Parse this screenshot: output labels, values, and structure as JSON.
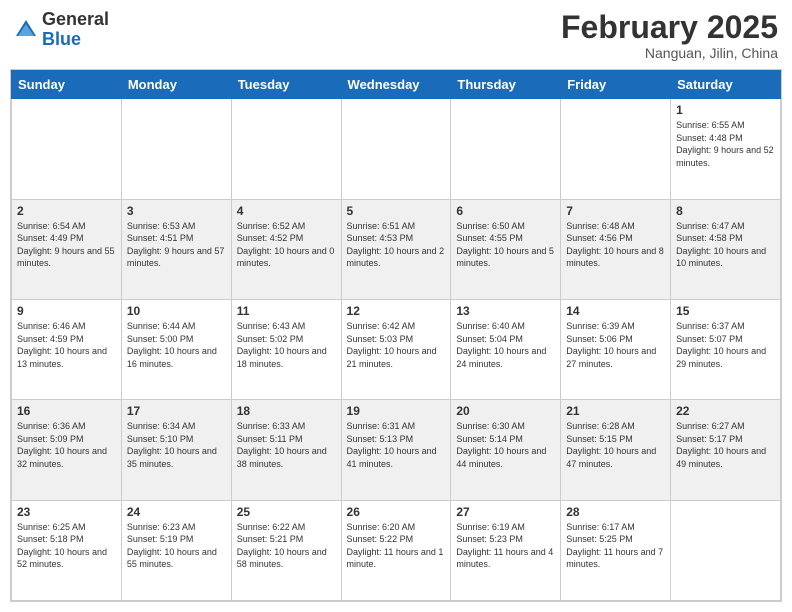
{
  "header": {
    "logo_general": "General",
    "logo_blue": "Blue",
    "month_year": "February 2025",
    "location": "Nanguan, Jilin, China"
  },
  "days_of_week": [
    "Sunday",
    "Monday",
    "Tuesday",
    "Wednesday",
    "Thursday",
    "Friday",
    "Saturday"
  ],
  "weeks": [
    [
      {
        "day": "",
        "info": ""
      },
      {
        "day": "",
        "info": ""
      },
      {
        "day": "",
        "info": ""
      },
      {
        "day": "",
        "info": ""
      },
      {
        "day": "",
        "info": ""
      },
      {
        "day": "",
        "info": ""
      },
      {
        "day": "1",
        "info": "Sunrise: 6:55 AM\nSunset: 4:48 PM\nDaylight: 9 hours and 52 minutes."
      }
    ],
    [
      {
        "day": "2",
        "info": "Sunrise: 6:54 AM\nSunset: 4:49 PM\nDaylight: 9 hours and 55 minutes."
      },
      {
        "day": "3",
        "info": "Sunrise: 6:53 AM\nSunset: 4:51 PM\nDaylight: 9 hours and 57 minutes."
      },
      {
        "day": "4",
        "info": "Sunrise: 6:52 AM\nSunset: 4:52 PM\nDaylight: 10 hours and 0 minutes."
      },
      {
        "day": "5",
        "info": "Sunrise: 6:51 AM\nSunset: 4:53 PM\nDaylight: 10 hours and 2 minutes."
      },
      {
        "day": "6",
        "info": "Sunrise: 6:50 AM\nSunset: 4:55 PM\nDaylight: 10 hours and 5 minutes."
      },
      {
        "day": "7",
        "info": "Sunrise: 6:48 AM\nSunset: 4:56 PM\nDaylight: 10 hours and 8 minutes."
      },
      {
        "day": "8",
        "info": "Sunrise: 6:47 AM\nSunset: 4:58 PM\nDaylight: 10 hours and 10 minutes."
      }
    ],
    [
      {
        "day": "9",
        "info": "Sunrise: 6:46 AM\nSunset: 4:59 PM\nDaylight: 10 hours and 13 minutes."
      },
      {
        "day": "10",
        "info": "Sunrise: 6:44 AM\nSunset: 5:00 PM\nDaylight: 10 hours and 16 minutes."
      },
      {
        "day": "11",
        "info": "Sunrise: 6:43 AM\nSunset: 5:02 PM\nDaylight: 10 hours and 18 minutes."
      },
      {
        "day": "12",
        "info": "Sunrise: 6:42 AM\nSunset: 5:03 PM\nDaylight: 10 hours and 21 minutes."
      },
      {
        "day": "13",
        "info": "Sunrise: 6:40 AM\nSunset: 5:04 PM\nDaylight: 10 hours and 24 minutes."
      },
      {
        "day": "14",
        "info": "Sunrise: 6:39 AM\nSunset: 5:06 PM\nDaylight: 10 hours and 27 minutes."
      },
      {
        "day": "15",
        "info": "Sunrise: 6:37 AM\nSunset: 5:07 PM\nDaylight: 10 hours and 29 minutes."
      }
    ],
    [
      {
        "day": "16",
        "info": "Sunrise: 6:36 AM\nSunset: 5:09 PM\nDaylight: 10 hours and 32 minutes."
      },
      {
        "day": "17",
        "info": "Sunrise: 6:34 AM\nSunset: 5:10 PM\nDaylight: 10 hours and 35 minutes."
      },
      {
        "day": "18",
        "info": "Sunrise: 6:33 AM\nSunset: 5:11 PM\nDaylight: 10 hours and 38 minutes."
      },
      {
        "day": "19",
        "info": "Sunrise: 6:31 AM\nSunset: 5:13 PM\nDaylight: 10 hours and 41 minutes."
      },
      {
        "day": "20",
        "info": "Sunrise: 6:30 AM\nSunset: 5:14 PM\nDaylight: 10 hours and 44 minutes."
      },
      {
        "day": "21",
        "info": "Sunrise: 6:28 AM\nSunset: 5:15 PM\nDaylight: 10 hours and 47 minutes."
      },
      {
        "day": "22",
        "info": "Sunrise: 6:27 AM\nSunset: 5:17 PM\nDaylight: 10 hours and 49 minutes."
      }
    ],
    [
      {
        "day": "23",
        "info": "Sunrise: 6:25 AM\nSunset: 5:18 PM\nDaylight: 10 hours and 52 minutes."
      },
      {
        "day": "24",
        "info": "Sunrise: 6:23 AM\nSunset: 5:19 PM\nDaylight: 10 hours and 55 minutes."
      },
      {
        "day": "25",
        "info": "Sunrise: 6:22 AM\nSunset: 5:21 PM\nDaylight: 10 hours and 58 minutes."
      },
      {
        "day": "26",
        "info": "Sunrise: 6:20 AM\nSunset: 5:22 PM\nDaylight: 11 hours and 1 minute."
      },
      {
        "day": "27",
        "info": "Sunrise: 6:19 AM\nSunset: 5:23 PM\nDaylight: 11 hours and 4 minutes."
      },
      {
        "day": "28",
        "info": "Sunrise: 6:17 AM\nSunset: 5:25 PM\nDaylight: 11 hours and 7 minutes."
      },
      {
        "day": "",
        "info": ""
      }
    ]
  ]
}
